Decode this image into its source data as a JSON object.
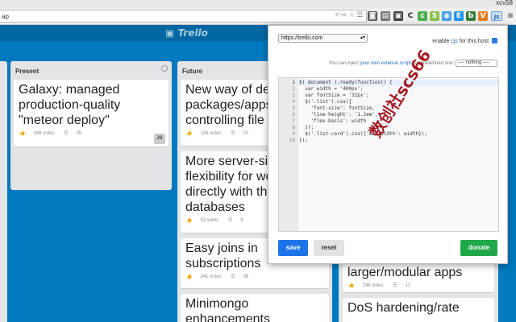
{
  "os": {
    "user": "xcv58"
  },
  "browser": {
    "url_text": "ap",
    "extensions": [
      "C",
      "c",
      "S",
      "E",
      "b",
      "V",
      "js"
    ]
  },
  "trello": {
    "logo": "Trello",
    "lists": [
      {
        "title": "Present",
        "cards": [
          {
            "title": "Galaxy: managed\nproduction-quality\n\"meteor deploy\"",
            "votes": "248 votes",
            "comments": "35",
            "avatar": "JS"
          }
        ]
      },
      {
        "title": "Future",
        "cards": [
          {
            "title": "New way of de\npackages/apps\ncontrolling file",
            "votes": "106 votes",
            "comments": "20"
          },
          {
            "title": "More server-sid\nflexibility for wo\ndirectly with th\ndatabases",
            "votes": "53 votes",
            "comments": "9"
          },
          {
            "title": "Easy joins in\nsubscriptions",
            "votes": "341 votes",
            "comments": "38"
          },
          {
            "title": "Minimongo\nenhancements",
            "votes": "",
            "comments": ""
          }
        ]
      },
      {
        "title": "",
        "cards": [
          {
            "title": "larger/modular apps",
            "votes": "296 votes",
            "comments": "11"
          },
          {
            "title": "DoS hardening/rate",
            "votes": "",
            "comments": ""
          }
        ]
      }
    ]
  },
  "popup": {
    "host": "https://trello.com",
    "enable_prefix": "enable ",
    "enable_em": "cjs",
    "enable_suffix": " for this host",
    "inject_prefix": "You can inject ",
    "inject_link": "your own external scripts",
    "inject_suffix": " or predefined one:",
    "inject_option": "---- nothing ----",
    "line_numbers": [
      "1",
      "2",
      "3",
      "4",
      "5",
      "6",
      "7",
      "8",
      "9",
      "10"
    ],
    "code_lines": [
      "$( document ).ready(function() {",
      "  var width = '400px';",
      "  var fontSize = '32px';",
      "  $('.list').css({",
      "    'font-size': fontSize,",
      "    'line-height': '1.2em',",
      "    'flex-basis': width",
      "  });",
      "  $('.list-card').css({'max-width': width});",
      "});"
    ],
    "save_label": "save",
    "reset_label": "reset",
    "donate_label": "donate"
  },
  "watermark": "数创社scs66",
  "colors": {
    "trello_blue": "#0079bf",
    "save": "#1e73e8",
    "donate": "#21a84a",
    "stamp": "#a0131c"
  }
}
